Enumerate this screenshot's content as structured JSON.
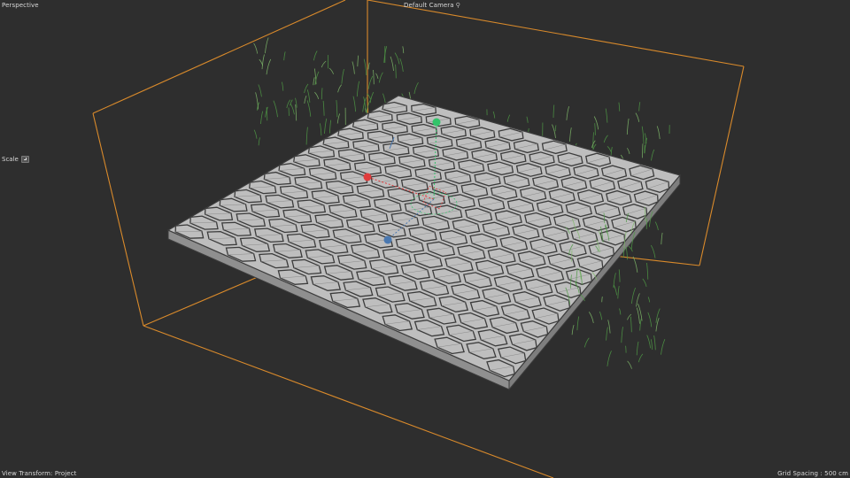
{
  "viewport": {
    "projection_label": "Perspective",
    "camera_label": "Default Camera",
    "camera_icon": "camera-icon",
    "scale_label": "Scale",
    "view_transform_label": "View Transform: Project",
    "grid_spacing_label": "Grid Spacing : 500 cm"
  },
  "colors": {
    "background": "#2e2e2e",
    "bounding_box": "#d98a2b",
    "tile_face": "#bebebe",
    "tile_side": "#8f8f8f",
    "tile_edge": "#3c3c3c",
    "grass": "#4f9a45",
    "axis_x": "#e03c3c",
    "axis_y": "#33c46a",
    "axis_z": "#4a78b0"
  }
}
